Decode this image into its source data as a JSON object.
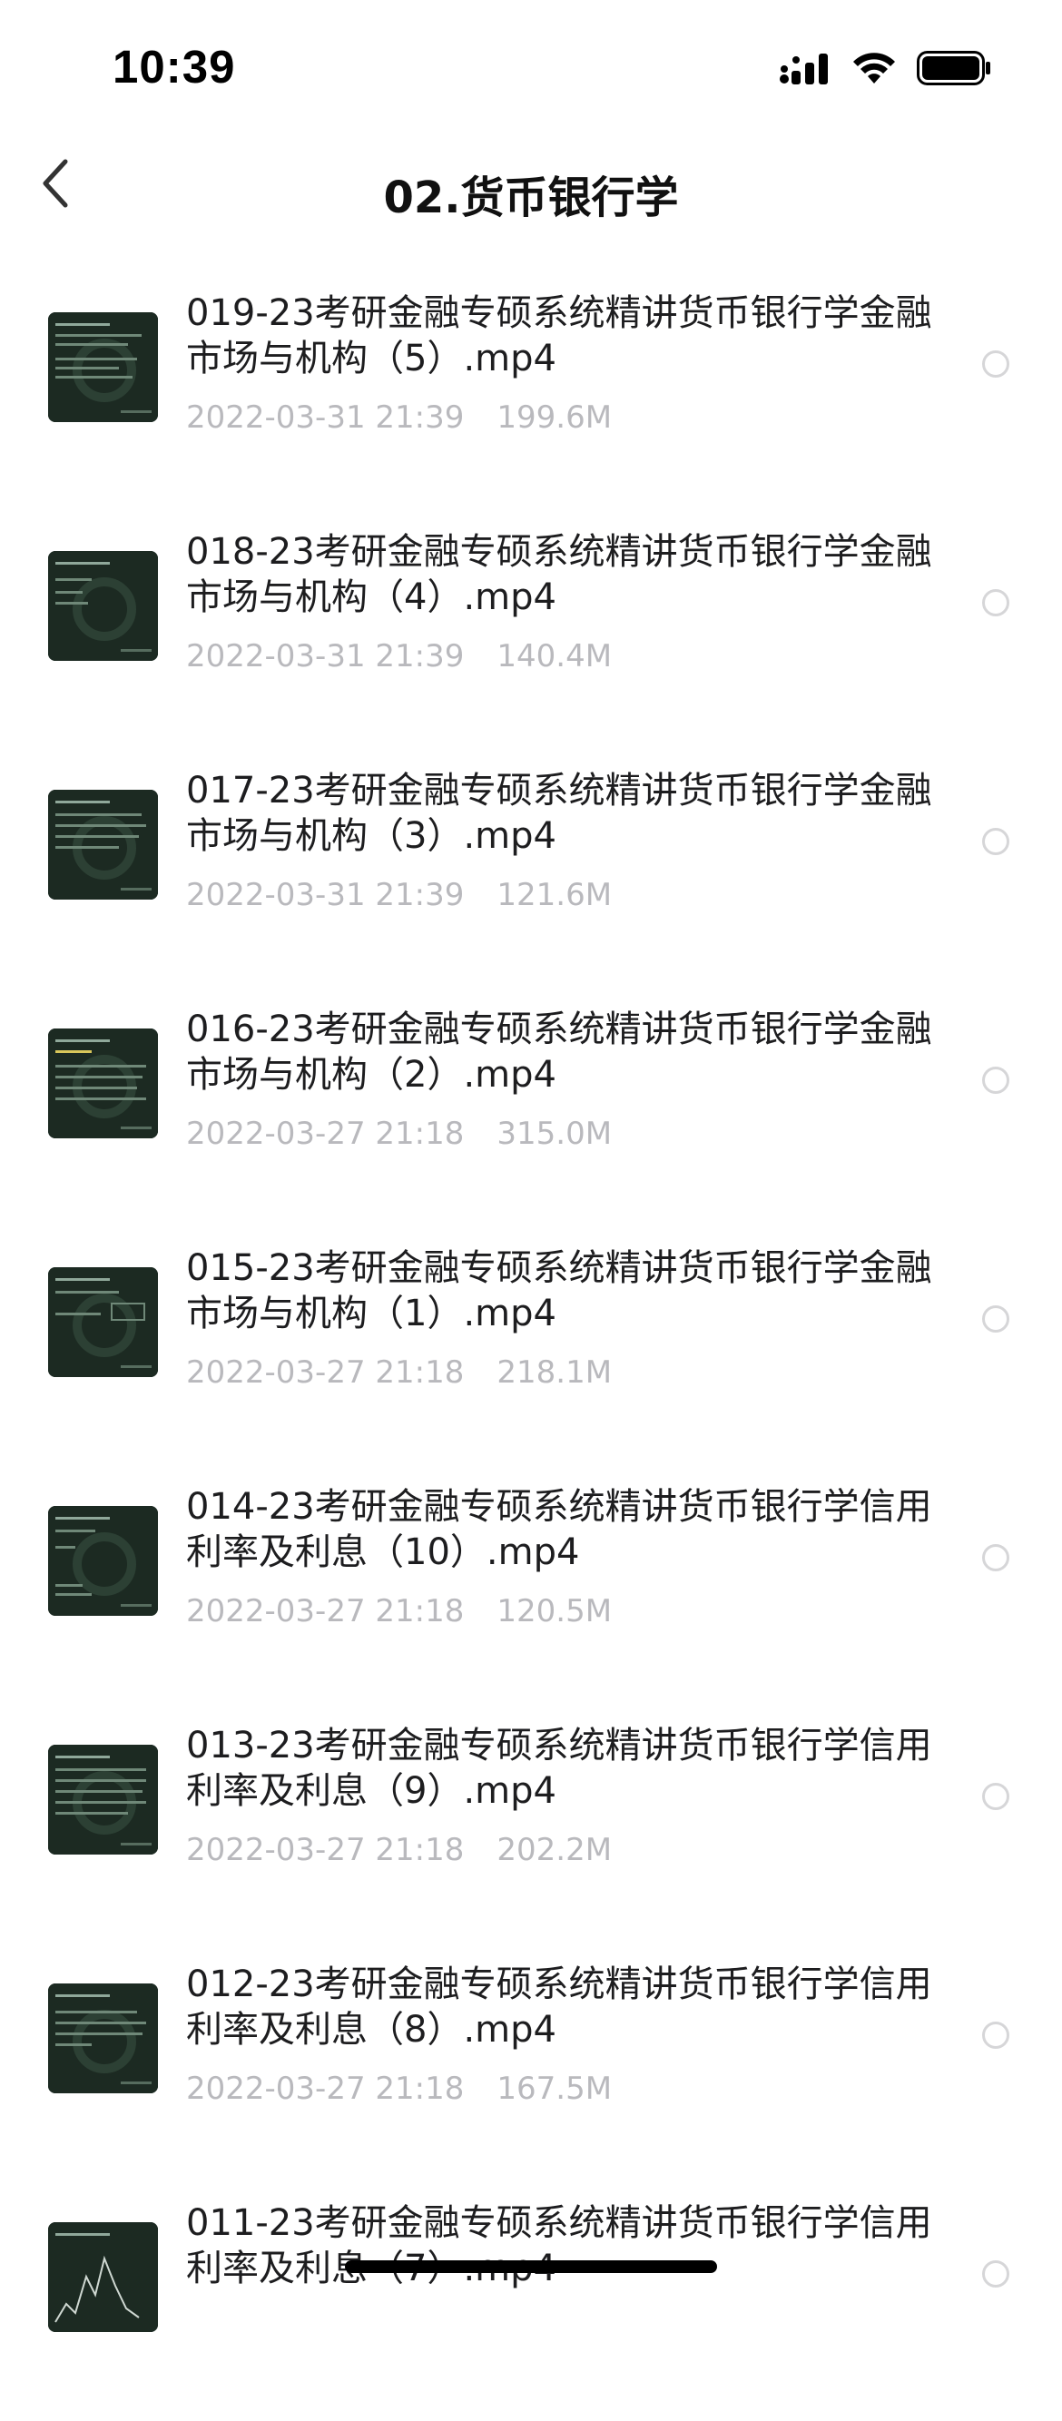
{
  "status_bar": {
    "time": "10:39",
    "icons": [
      "cellular-signal-icon",
      "wifi-icon",
      "battery-icon"
    ]
  },
  "nav": {
    "back_icon": "chevron-left-icon",
    "title": "02.货币银行学"
  },
  "colors": {
    "title": "#111111",
    "meta": "#b9b9bd",
    "radio_border": "#d6d6d8",
    "thumb_bg": "#1c2a22"
  },
  "files": [
    {
      "name": "019-23考研金融专硕系统精讲货币银行学金融市场与机构（5）.mp4",
      "date": "2022-03-31 21:39",
      "size": "199.6M"
    },
    {
      "name": "018-23考研金融专硕系统精讲货币银行学金融市场与机构（4）.mp4",
      "date": "2022-03-31 21:39",
      "size": "140.4M"
    },
    {
      "name": "017-23考研金融专硕系统精讲货币银行学金融市场与机构（3）.mp4",
      "date": "2022-03-31 21:39",
      "size": "121.6M"
    },
    {
      "name": "016-23考研金融专硕系统精讲货币银行学金融市场与机构（2）.mp4",
      "date": "2022-03-27 21:18",
      "size": "315.0M"
    },
    {
      "name": "015-23考研金融专硕系统精讲货币银行学金融市场与机构（1）.mp4",
      "date": "2022-03-27 21:18",
      "size": "218.1M"
    },
    {
      "name": "014-23考研金融专硕系统精讲货币银行学信用利率及利息（10）.mp4",
      "date": "2022-03-27 21:18",
      "size": "120.5M"
    },
    {
      "name": "013-23考研金融专硕系统精讲货币银行学信用利率及利息（9）.mp4",
      "date": "2022-03-27 21:18",
      "size": "202.2M"
    },
    {
      "name": "012-23考研金融专硕系统精讲货币银行学信用利率及利息（8）.mp4",
      "date": "2022-03-27 21:18",
      "size": "167.5M"
    },
    {
      "name": "011-23考研金融专硕系统精讲货币银行学信用利率及利息（7）.mp4",
      "date": "",
      "size": ""
    }
  ]
}
